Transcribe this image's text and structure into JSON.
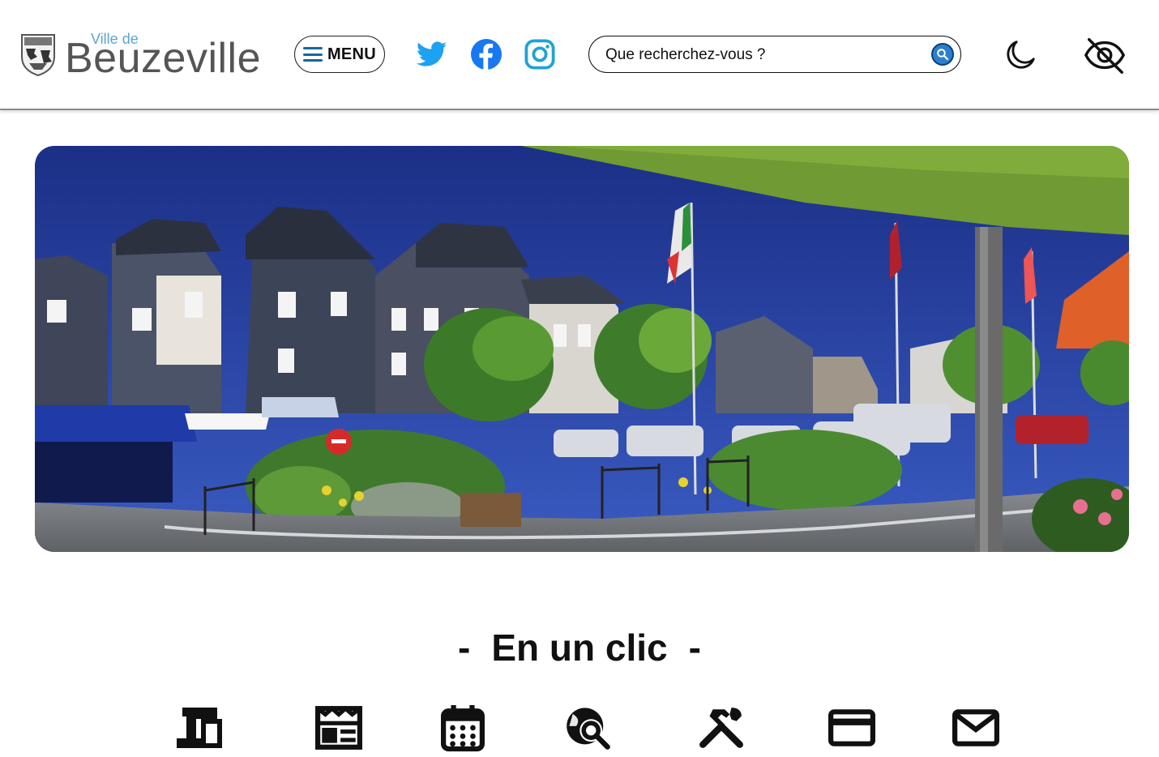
{
  "site": {
    "logo_prefix": "Ville de",
    "logo_name": "Beuzeville"
  },
  "header": {
    "menu_label": "MENU",
    "social": [
      {
        "icon": "twitter-icon",
        "color": "#1da1f2"
      },
      {
        "icon": "facebook-icon",
        "color": "#1778f2"
      },
      {
        "icon": "instagram-icon",
        "color": "#1fa3d6"
      }
    ],
    "search": {
      "placeholder": "Que recherchez-vous ?",
      "button_icon": "search-icon"
    },
    "tools": [
      {
        "icon": "moon-icon"
      },
      {
        "icon": "eye-slash-icon"
      }
    ]
  },
  "hero": {
    "image": "town-square-photo"
  },
  "quick_links": {
    "title": "En un clic",
    "dash_left": "-",
    "dash_right": "-",
    "items": [
      {
        "icon": "devices-icon"
      },
      {
        "icon": "newspaper-icon"
      },
      {
        "icon": "calendar-icon"
      },
      {
        "icon": "travel-explore-icon"
      },
      {
        "icon": "tools-icon"
      },
      {
        "icon": "credit-card-icon"
      },
      {
        "icon": "mail-icon"
      }
    ]
  },
  "colors": {
    "accent": "#1da1f2",
    "logo_small": "#59a7cf",
    "search_button": "#2a7fd0"
  }
}
